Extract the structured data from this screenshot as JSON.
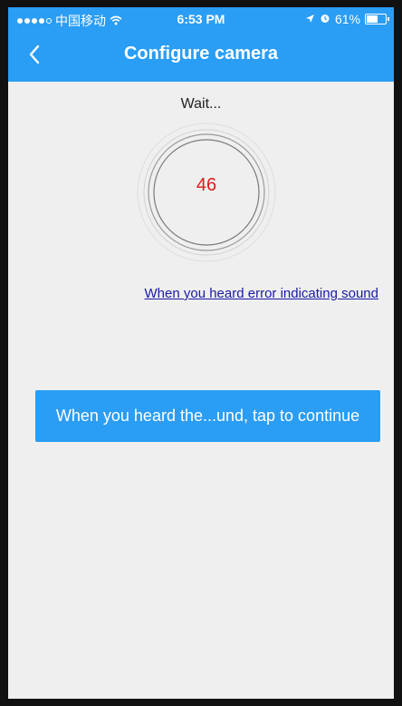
{
  "status_bar": {
    "carrier": "中国移动",
    "time": "6:53 PM",
    "battery": "61%",
    "battery_level": 0.61
  },
  "navbar": {
    "title": "Configure camera"
  },
  "content": {
    "wait_text": "Wait...",
    "countdown": "46",
    "error_link": "When you heard error indicating sound",
    "continue_button": "When you heard the...und, tap to continue"
  },
  "colors": {
    "accent": "#2a9df4",
    "countdown": "#e11b1b",
    "link": "#1a1aa8",
    "background": "#efefef"
  },
  "icons": {
    "back": "chevron-left-icon",
    "wifi": "wifi-icon",
    "location": "location-arrow-icon",
    "alarm": "alarm-icon",
    "battery": "battery-icon"
  }
}
